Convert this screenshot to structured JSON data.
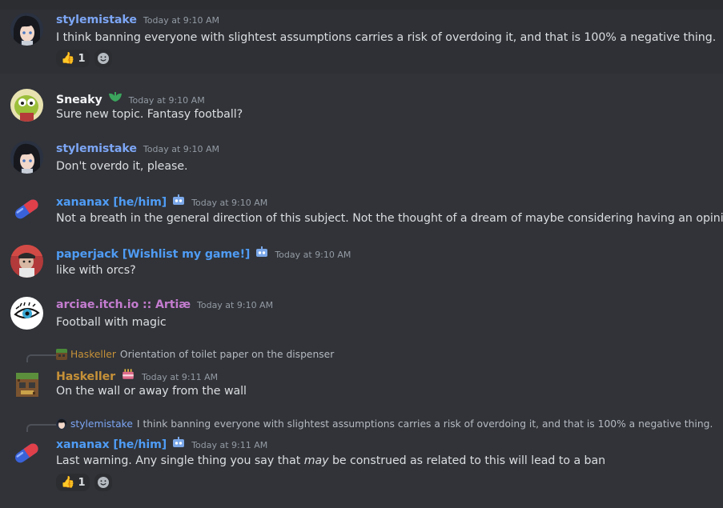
{
  "messages": [
    {
      "author": "stylemistake",
      "time": "Today at 9:10 AM",
      "text": "I think banning everyone with slightest assumptions carries a risk of overdoing it, and that is 100% a negative thing.",
      "reaction": {
        "emoji": "👍",
        "count": "1"
      }
    },
    {
      "author": "Sneaky",
      "time": "Today at 9:10 AM",
      "text": "Sure new topic. Fantasy football?"
    },
    {
      "author": "stylemistake",
      "time": "Today at 9:10 AM",
      "text": "Don't overdo it, please."
    },
    {
      "author": "xananax [he/him]",
      "time": "Today at 9:10 AM",
      "text": "Not a breath in the general direction of this subject. Not the thought of a dream of maybe considering having an opinion"
    },
    {
      "author": "paperjack [Wishlist my game!]",
      "time": "Today at 9:10 AM",
      "text": "like with orcs?"
    },
    {
      "author": "arciae.itch.io :: Artiæ",
      "time": "Today at 9:10 AM",
      "text": "Football with magic"
    },
    {
      "reply": {
        "author": "Haskeller",
        "text": "Orientation of toilet paper on the dispenser"
      },
      "author": "Haskeller",
      "time": "Today at 9:11 AM",
      "text": "On the wall or away from the wall"
    },
    {
      "reply": {
        "author": "stylemistake",
        "text": "I think banning everyone with slightest assumptions carries a risk of overdoing it, and that is 100% a negative thing."
      },
      "author": "xananax [he/him]",
      "time": "Today at 9:11 AM",
      "text_a": "Last warning. Any single thing you say that ",
      "text_em": "may",
      "text_b": " be construed as related to this will lead to a ban",
      "reaction": {
        "emoji": "👍",
        "count": "1"
      }
    }
  ],
  "colors": {
    "stylemistake": "#7da6f5",
    "sneaky": "#f2f3f5",
    "xananax": "#4f9cf5",
    "paperjack": "#4f9cf5",
    "arciae": "#c37ccf",
    "haskeller": "#c69138"
  }
}
